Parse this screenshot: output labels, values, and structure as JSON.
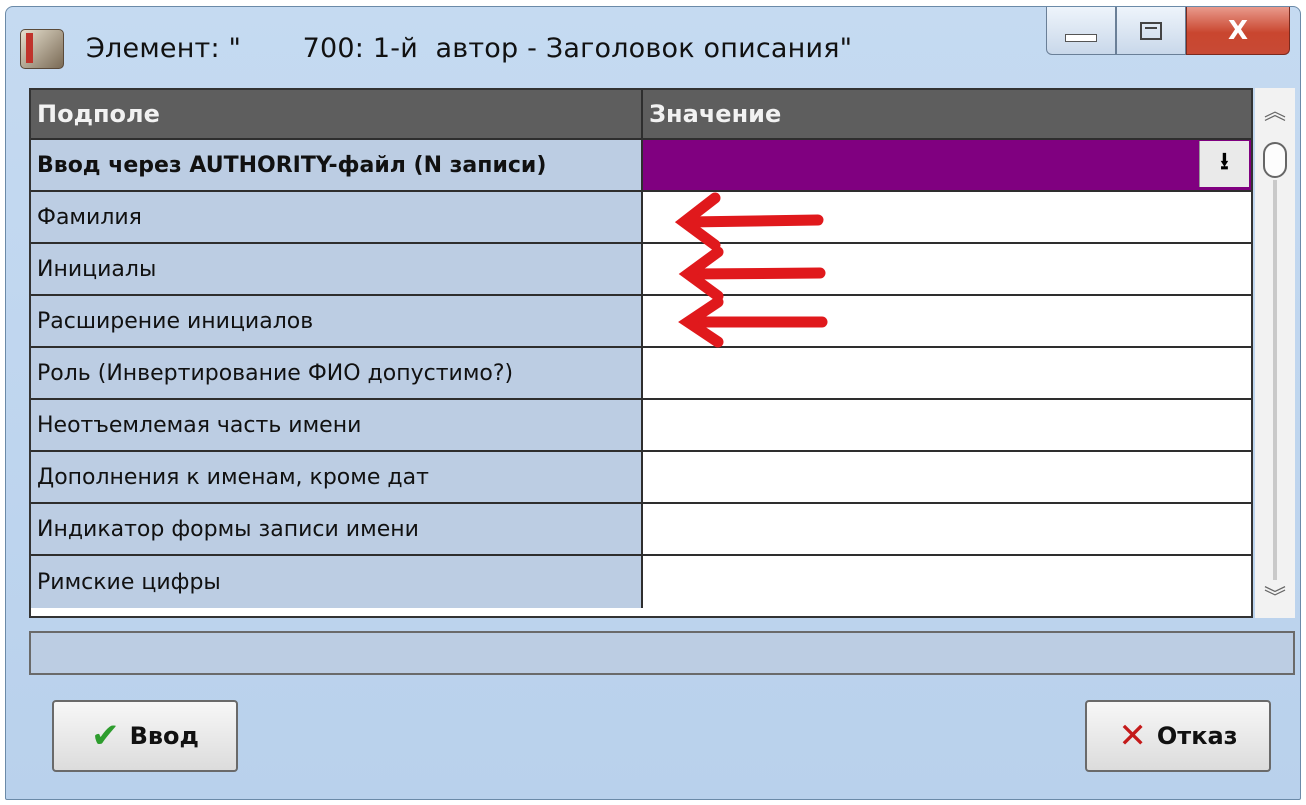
{
  "window": {
    "title": "Элемент: \"       700: 1-й  автор - Заголовок описания\"",
    "buttons": {
      "minimize": "minimize",
      "maximize": "maximize",
      "close": "X"
    }
  },
  "grid": {
    "headers": {
      "subfield": "Подполе",
      "value": "Значение"
    },
    "rows": [
      {
        "label": "Ввод через AUTHORITY-файл (N записи)",
        "value": ""
      },
      {
        "label": "Фамилия",
        "value": ""
      },
      {
        "label": "Инициалы",
        "value": ""
      },
      {
        "label": "Расширение инициалов",
        "value": ""
      },
      {
        "label": "Роль (Инвертирование ФИО допустимо?)",
        "value": ""
      },
      {
        "label": "Неотъемлемая часть имени",
        "value": ""
      },
      {
        "label": "Дополнения к именам, кроме дат",
        "value": ""
      },
      {
        "label": "Индикатор формы записи имени",
        "value": ""
      },
      {
        "label": "Римские цифры",
        "value": ""
      }
    ],
    "selected_row_color": "#800080",
    "label_background": "#bccde3",
    "header_background": "#5e5e5e"
  },
  "icons": {
    "dropdown": "download-arrow-icon",
    "ok": "checkmark-icon",
    "cancel": "cross-icon",
    "annotation": "red-arrow-icon"
  },
  "status_text": "",
  "actions": {
    "ok_label": "Ввод",
    "cancel_label": "Отказ"
  },
  "annotation": {
    "color": "#e0191c",
    "arrow_count": 3
  }
}
